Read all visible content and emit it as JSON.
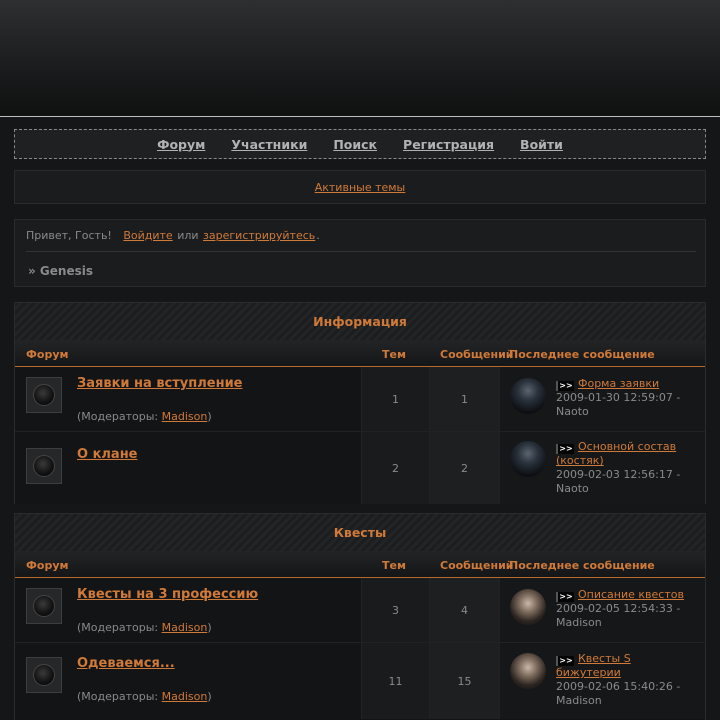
{
  "nav": {
    "items": [
      "Форум",
      "Участники",
      "Поиск",
      "Регистрация",
      "Войти"
    ]
  },
  "active_topics": "Активные темы",
  "welcome": {
    "greeting": "Привет, Гость!",
    "login_link": "Войдите",
    "or": "или",
    "register_link": "зарегистрируйтесь",
    "dot": ".",
    "breadcrumb": "» Genesis"
  },
  "columns": {
    "forum": "Форум",
    "topics": "Тем",
    "posts": "Сообщений",
    "last": "Последнее сообщение"
  },
  "moderators_prefix": "(Модераторы:",
  "moderators_suffix": ")",
  "categories": [
    {
      "title": "Информация",
      "forums": [
        {
          "name": "Заявки на вступление",
          "moderator": "Madison",
          "topics": "1",
          "posts": "1",
          "last_title": "Форма заявки",
          "last_date": "2009-01-30 12:59:07 -",
          "last_author": "Naoto",
          "avatar": "dark"
        },
        {
          "name": "О клане",
          "moderator": "",
          "topics": "2",
          "posts": "2",
          "last_title": "Основной состав (костяк)",
          "last_date": "2009-02-03 12:56:17 -",
          "last_author": "Naoto",
          "avatar": "dark"
        }
      ]
    },
    {
      "title": "Квесты",
      "forums": [
        {
          "name": "Квесты на 3 профессию",
          "moderator": "Madison",
          "topics": "3",
          "posts": "4",
          "last_title": "Описание квестов",
          "last_date": "2009-02-05 12:54:33 -",
          "last_author": "Madison",
          "avatar": "light"
        },
        {
          "name": "Одеваемся...",
          "moderator": "Madison",
          "topics": "11",
          "posts": "15",
          "last_title": "Квесты S бижутерии",
          "last_date": "2009-02-06 15:40:26 -",
          "last_author": "Madison",
          "avatar": "light"
        }
      ]
    }
  ],
  "icons": {
    "forum_icon": "dark-disc-icon",
    "post_icon": "arrow-post-icon"
  },
  "colors": {
    "accent": "#d07a3a",
    "background": "#151617",
    "text": "#8a8a8a"
  }
}
